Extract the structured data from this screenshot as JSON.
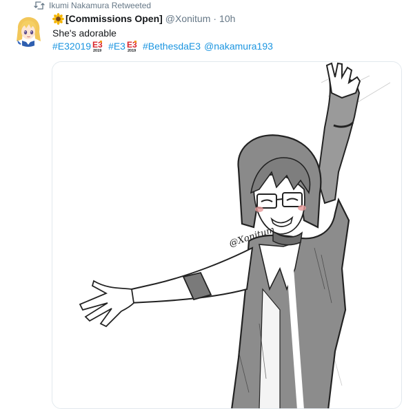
{
  "retweet": {
    "icon": "retweet-icon",
    "text": "Ikumi Nakamura Retweeted"
  },
  "author": {
    "display_name_prefix_icon": "sunflower-icon",
    "display_name": "[Commissions Open]",
    "handle": "@Xonitum",
    "separator": "·",
    "time": "10h",
    "avatar_icon": "anime-avatar"
  },
  "tweet": {
    "text": "She's adorable",
    "hashtags": [
      "#E32019",
      "#E3",
      "#BethesdaE3"
    ],
    "mention": "@nakamura193",
    "e3_badge_text": "E3",
    "e3_badge_year": "2019"
  },
  "media": {
    "signature": "@Xonitum",
    "description_icon": "sketch-image"
  },
  "colors": {
    "link": "#1b95e0",
    "secondary": "#657786",
    "text": "#14171a",
    "border": "#e1e8ed",
    "e3_red": "#d8232a",
    "e3_orange": "#f39a1e"
  }
}
